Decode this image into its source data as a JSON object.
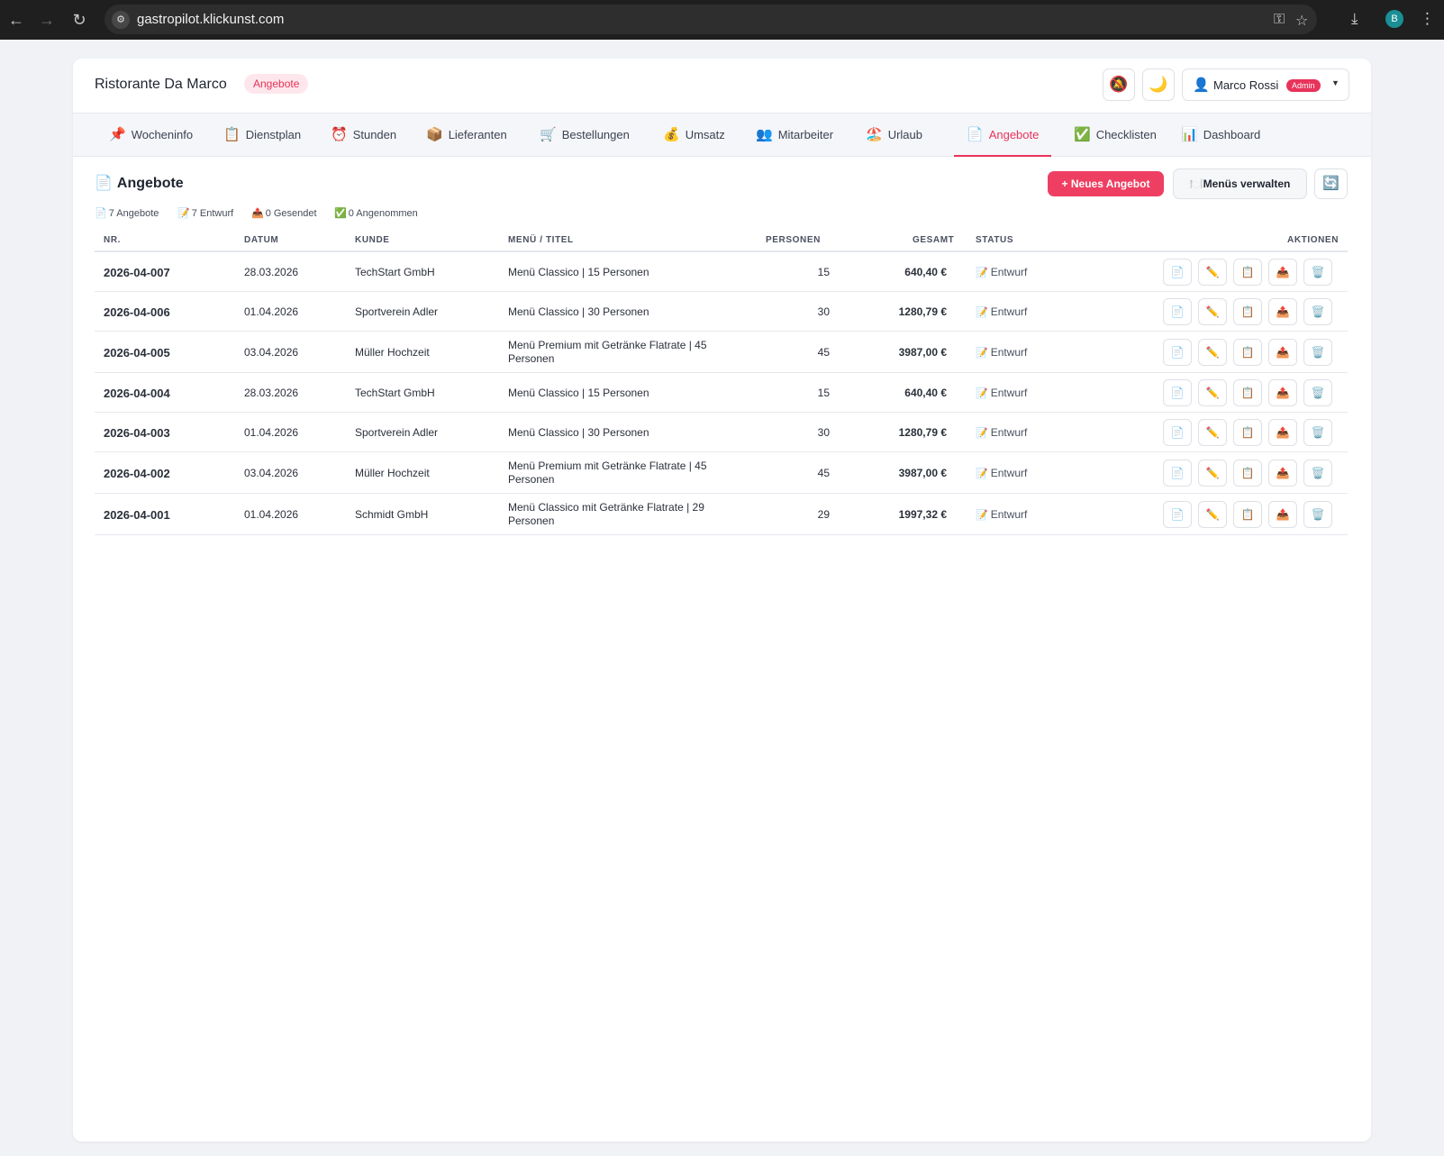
{
  "browser": {
    "url": "gastropilot.klickunst.com",
    "profile_initial": "B"
  },
  "header": {
    "restaurant": "Ristorante Da Marco",
    "page_badge": "Angebote",
    "user_name": "Marco Rossi",
    "user_role": "Admin",
    "notify_icon": "🔕",
    "theme_icon": "🌙",
    "user_icon": "👤"
  },
  "tabs": [
    {
      "icon": "📌",
      "label": "Wocheninfo"
    },
    {
      "icon": "📋",
      "label": "Dienstplan"
    },
    {
      "icon": "⏰",
      "label": "Stunden"
    },
    {
      "icon": "📦",
      "label": "Lieferanten"
    },
    {
      "icon": "🛒",
      "label": "Bestellungen"
    },
    {
      "icon": "💰",
      "label": "Umsatz"
    },
    {
      "icon": "👥",
      "label": "Mitarbeiter"
    },
    {
      "icon": "🏖️",
      "label": "Urlaub"
    },
    {
      "icon": "📄",
      "label": "Angebote"
    },
    {
      "icon": "✅",
      "label": "Checklisten"
    },
    {
      "icon": "📊",
      "label": "Dashboard"
    }
  ],
  "active_tab": "Angebote",
  "section": {
    "icon": "📄",
    "title": "Angebote",
    "new_button": "+ Neues Angebot",
    "menus_button": "Menüs verwalten",
    "menus_icon": "🍽️",
    "refresh_icon": "🔄"
  },
  "stats": [
    {
      "icon": "📄",
      "label": "7 Angebote"
    },
    {
      "icon": "📝",
      "label": "7 Entwurf"
    },
    {
      "icon": "📤",
      "label": "0 Gesendet"
    },
    {
      "icon": "✅",
      "label": "0 Angenommen"
    }
  ],
  "table": {
    "columns": {
      "nr": "NR.",
      "datum": "DATUM",
      "kunde": "KUNDE",
      "menu": "MENÜ / TITEL",
      "personen": "PERSONEN",
      "gesamt": "GESAMT",
      "status": "STATUS",
      "aktionen": "AKTIONEN"
    },
    "status_icon": "📝",
    "action_icons": [
      "📄",
      "✏️",
      "📋",
      "📤",
      "🗑️"
    ],
    "rows": [
      {
        "nr": "2026-04-007",
        "datum": "28.03.2026",
        "kunde": "TechStart GmbH",
        "menu": "Menü Classico | 15 Personen",
        "personen": "15",
        "gesamt": "640,40 €",
        "status": "Entwurf"
      },
      {
        "nr": "2026-04-006",
        "datum": "01.04.2026",
        "kunde": "Sportverein Adler",
        "menu": "Menü Classico | 30 Personen",
        "personen": "30",
        "gesamt": "1280,79 €",
        "status": "Entwurf"
      },
      {
        "nr": "2026-04-005",
        "datum": "03.04.2026",
        "kunde": "Müller Hochzeit",
        "menu": "Menü Premium mit Getränke Flatrate | 45 Personen",
        "personen": "45",
        "gesamt": "3987,00 €",
        "status": "Entwurf"
      },
      {
        "nr": "2026-04-004",
        "datum": "28.03.2026",
        "kunde": "TechStart GmbH",
        "menu": "Menü Classico | 15 Personen",
        "personen": "15",
        "gesamt": "640,40 €",
        "status": "Entwurf"
      },
      {
        "nr": "2026-04-003",
        "datum": "01.04.2026",
        "kunde": "Sportverein Adler",
        "menu": "Menü Classico | 30 Personen",
        "personen": "30",
        "gesamt": "1280,79 €",
        "status": "Entwurf"
      },
      {
        "nr": "2026-04-002",
        "datum": "03.04.2026",
        "kunde": "Müller Hochzeit",
        "menu": "Menü Premium mit Getränke Flatrate | 45 Personen",
        "personen": "45",
        "gesamt": "3987,00 €",
        "status": "Entwurf"
      },
      {
        "nr": "2026-04-001",
        "datum": "01.04.2026",
        "kunde": "Schmidt GmbH",
        "menu": "Menü Classico mit Getränke Flatrate | 29 Personen",
        "personen": "29",
        "gesamt": "1997,32 €",
        "status": "Entwurf"
      }
    ]
  }
}
